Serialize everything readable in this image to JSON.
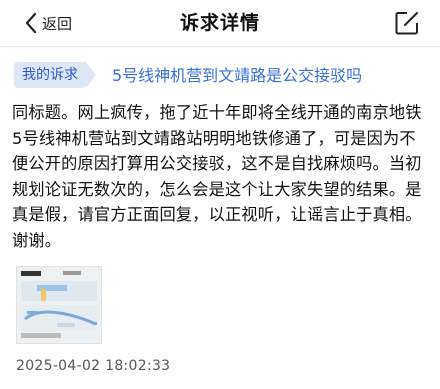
{
  "header": {
    "back_label": "返回",
    "title": "诉求详情",
    "back_icon": "chevron-left-icon",
    "share_icon": "external-link-icon"
  },
  "complaint": {
    "tag_label": "我的诉求",
    "subject": "5号线神机营到文靖路是公交接驳吗",
    "body": "同标题。网上疯传，拖了近十年即将全线开通的南京地铁5号线神机营站到文靖路站明明地铁修通了，可是因为不便公开的原因打算用公交接驳，这不是自找麻烦吗。当初规划论证无数次的，怎么会是这个让大家失望的结果。是真是假，请官方正面回复，以正视听，让谣言止于真相。谢谢。",
    "attachment": "map-screenshot-thumbnail",
    "timestamp": "2025-04-02 18:02:33"
  },
  "colors": {
    "tag_bg": "#dde6f5",
    "tag_text": "#2f58c8",
    "subject_text": "#3a6fd8"
  }
}
